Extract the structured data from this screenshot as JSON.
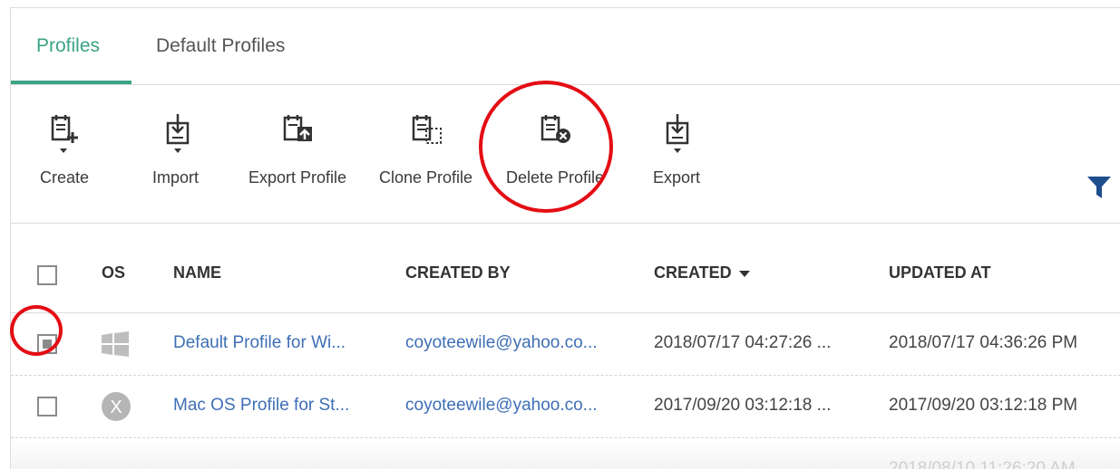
{
  "tabs": [
    {
      "label": "Profiles",
      "active": true
    },
    {
      "label": "Default Profiles",
      "active": false
    }
  ],
  "toolbar": {
    "items": [
      {
        "label": "Create",
        "icon": "create-profile-icon"
      },
      {
        "label": "Import",
        "icon": "import-icon"
      },
      {
        "label": "Export Profile",
        "icon": "export-profile-icon"
      },
      {
        "label": "Clone Profile",
        "icon": "clone-profile-icon"
      },
      {
        "label": "Delete Profile",
        "icon": "delete-profile-icon"
      },
      {
        "label": "Export",
        "icon": "export-icon"
      }
    ],
    "filter_icon": "filter-icon"
  },
  "table": {
    "columns": [
      "OS",
      "NAME",
      "CREATED BY",
      "CREATED",
      "UPDATED AT"
    ],
    "sorted_column": "CREATED",
    "rows": [
      {
        "os": "windows-icon",
        "name": "Default Profile for Wi...",
        "created_by": "coyoteewile@yahoo.co...",
        "created": "2018/07/17 04:27:26 ...",
        "updated_at": "2018/07/17 04:36:26 PM",
        "selected": true
      },
      {
        "os": "mac-os-icon",
        "name": "Mac OS Profile for St...",
        "created_by": "coyoteewile@yahoo.co...",
        "created": "2017/09/20 03:12:18 ...",
        "updated_at": "2017/09/20 03:12:18 PM",
        "selected": false
      }
    ],
    "partial_row_updated": "2018/08/10 11:26:20 AM"
  },
  "colors": {
    "accent": "#3aa385",
    "link": "#3e6fb5",
    "highlight": "#e40d14",
    "filter": "#1f4e8c"
  }
}
